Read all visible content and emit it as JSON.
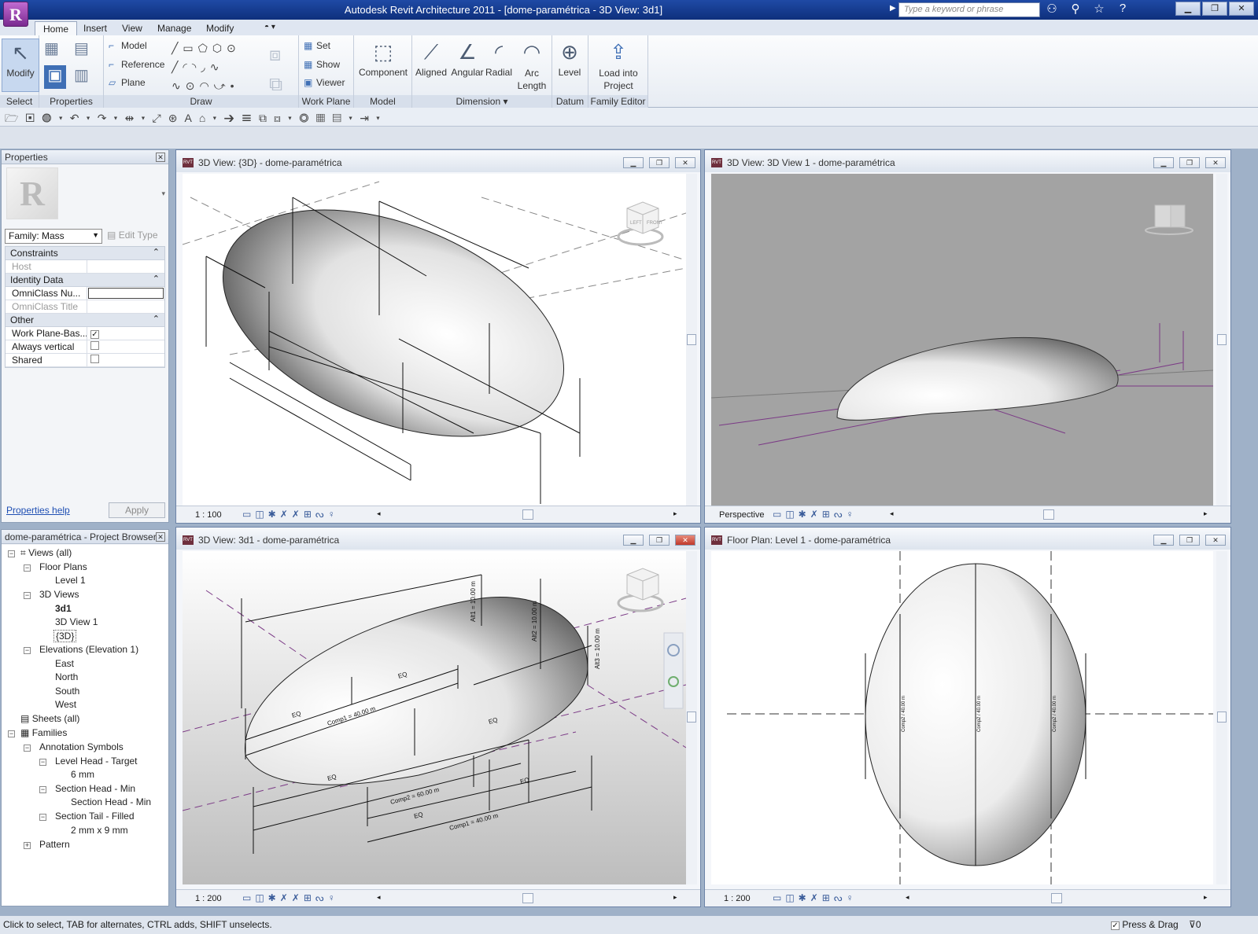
{
  "titlebar": {
    "app_title": "Autodesk Revit Architecture 2011 - [dome-paramétrica - 3D View: 3d1]",
    "search_placeholder": "Type a keyword or phrase",
    "logo": "R"
  },
  "tabs": [
    "Home",
    "Insert",
    "View",
    "Manage",
    "Modify"
  ],
  "ribbon": {
    "select": {
      "modify": "Modify",
      "title": "Select"
    },
    "properties": {
      "title": "Properties"
    },
    "draw": {
      "model": "Model",
      "reference": "Reference",
      "plane": "Plane",
      "title": "Draw"
    },
    "work_plane": {
      "set": "Set",
      "show": "Show",
      "viewer": "Viewer",
      "title": "Work Plane"
    },
    "model": {
      "component": "Component",
      "title": "Model"
    },
    "dimension": {
      "aligned": "Aligned",
      "angular": "Angular",
      "radial": "Radial",
      "arc_length_1": "Arc",
      "arc_length_2": "Length",
      "title": "Dimension"
    },
    "datum": {
      "level": "Level",
      "title": "Datum"
    },
    "family_editor": {
      "load_1": "Load into",
      "load_2": "Project",
      "title": "Family Editor"
    }
  },
  "properties_panel": {
    "title": "Properties",
    "family_selector": "Family: Mass",
    "edit_type": "Edit Type",
    "groups": {
      "constraints": "Constraints",
      "host": "Host",
      "identity_data": "Identity Data",
      "omniclass_number": "OmniClass Nu...",
      "omniclass_title": "OmniClass Title",
      "other": "Other",
      "work_plane_based": "Work Plane-Bas...",
      "always_vertical": "Always vertical",
      "shared": "Shared"
    },
    "help_link": "Properties help",
    "apply": "Apply"
  },
  "project_browser": {
    "title": "dome-paramétrica - Project Browser",
    "items": {
      "views_all": "Views (all)",
      "floor_plans": "Floor Plans",
      "level_1": "Level 1",
      "views_3d": "3D Views",
      "v_3d1": "3d1",
      "v_3d_view_1": "3D View 1",
      "v_3d": "{3D}",
      "elevations": "Elevations (Elevation 1)",
      "east": "East",
      "north": "North",
      "south": "South",
      "west": "West",
      "sheets_all": "Sheets (all)",
      "families": "Families",
      "annotation_symbols": "Annotation Symbols",
      "level_head_target": "Level Head - Target",
      "six_mm": "6 mm",
      "section_head_min": "Section Head - Min",
      "section_head_min_type": "Section Head - Min",
      "section_tail_filled": "Section Tail - Filled",
      "two_by_nine": "2 mm x 9 mm",
      "pattern": "Pattern"
    }
  },
  "views": [
    {
      "title": "3D View: {3D} - dome-paramétrica",
      "scale": "1 : 100"
    },
    {
      "title": "3D View: 3D View 1 - dome-paramétrica",
      "scale": "Perspective"
    },
    {
      "title": "3D View: 3d1 - dome-paramétrica",
      "scale": "1 : 200"
    },
    {
      "title": "Floor Plan: Level 1 - dome-paramétrica",
      "scale": "1 : 200"
    }
  ],
  "annotations": {
    "eq": "EQ",
    "comp1": "Comp1 = 40.00 m",
    "comp2": "Comp2 = 60.00 m",
    "alt1": "Alt1 = 10.00 m",
    "alt2": "Alt2 = 10.00 m",
    "alt3": "Alt3 = 10.00 m",
    "plan_dim": "Comp2 / 40.00 m",
    "viewcube_front": "FRONT",
    "viewcube_left": "LEFT"
  },
  "statusbar": {
    "hint": "Click to select, TAB for alternates, CTRL adds, SHIFT unselects.",
    "press_drag": "Press & Drag",
    "filter_count": "0"
  },
  "colors": {
    "title_bar": "#1f4aa5",
    "canvas_gray": "#a3a3a3",
    "reference_line": "#7b3a86"
  }
}
